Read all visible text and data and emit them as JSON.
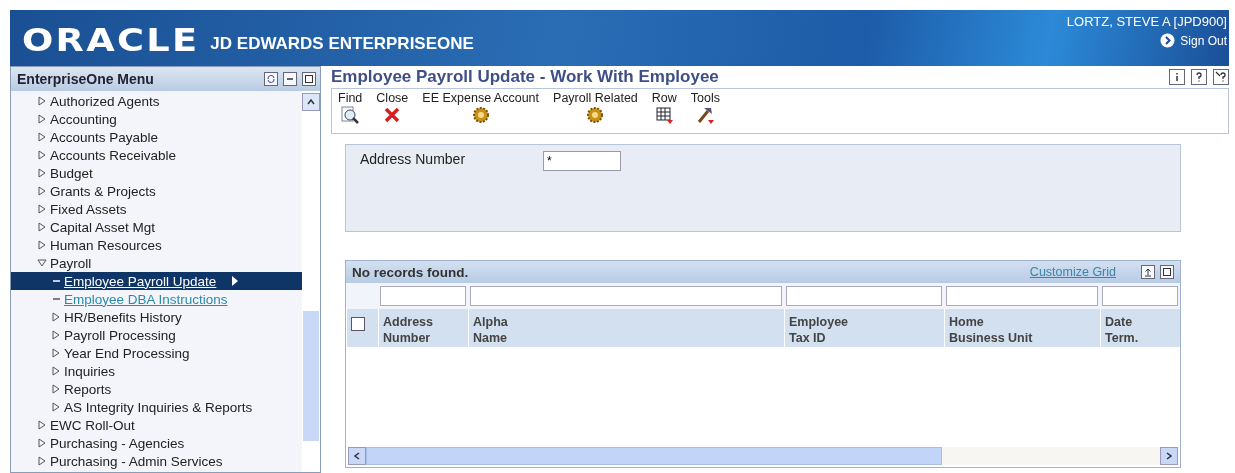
{
  "header": {
    "logo": "ORACLE",
    "product": "JD EDWARDS ENTERPRISEONE",
    "user": "LORTZ, STEVE A  [JPD900]",
    "sign_out": "Sign Out"
  },
  "sidebar": {
    "title": "EnterpriseOne Menu",
    "items": [
      {
        "label": "Authorized Agents",
        "kind": "folder",
        "expanded": false,
        "selected": false
      },
      {
        "label": "Accounting",
        "kind": "folder",
        "expanded": false,
        "selected": false
      },
      {
        "label": "Accounts Payable",
        "kind": "folder",
        "expanded": false,
        "selected": false
      },
      {
        "label": "Accounts Receivable",
        "kind": "folder",
        "expanded": false,
        "selected": false
      },
      {
        "label": "Budget",
        "kind": "folder",
        "expanded": false,
        "selected": false
      },
      {
        "label": "Grants & Projects",
        "kind": "folder",
        "expanded": false,
        "selected": false
      },
      {
        "label": "Fixed Assets",
        "kind": "folder",
        "expanded": false,
        "selected": false
      },
      {
        "label": "Capital Asset Mgt",
        "kind": "folder",
        "expanded": false,
        "selected": false
      },
      {
        "label": "Human Resources",
        "kind": "folder",
        "expanded": false,
        "selected": false
      },
      {
        "label": "Payroll",
        "kind": "folder",
        "expanded": true,
        "selected": false,
        "children": [
          {
            "label": "Employee Payroll Update",
            "kind": "task",
            "selected": true
          },
          {
            "label": "Employee DBA Instructions",
            "kind": "task",
            "selected": false
          },
          {
            "label": "HR/Benefits History",
            "kind": "folder",
            "expanded": false,
            "selected": false
          },
          {
            "label": "Payroll Processing",
            "kind": "folder",
            "expanded": false,
            "selected": false
          },
          {
            "label": "Year End Processing",
            "kind": "folder",
            "expanded": false,
            "selected": false
          },
          {
            "label": "Inquiries",
            "kind": "folder",
            "expanded": false,
            "selected": false
          },
          {
            "label": "Reports",
            "kind": "folder",
            "expanded": false,
            "selected": false
          },
          {
            "label": "AS Integrity Inquiries & Reports",
            "kind": "folder",
            "expanded": false,
            "selected": false
          }
        ]
      },
      {
        "label": "EWC Roll-Out",
        "kind": "folder",
        "expanded": false,
        "selected": false
      },
      {
        "label": "Purchasing - Agencies",
        "kind": "folder",
        "expanded": false,
        "selected": false
      },
      {
        "label": "Purchasing - Admin Services",
        "kind": "folder",
        "expanded": false,
        "selected": false
      }
    ]
  },
  "form": {
    "title": "Employee Payroll Update - Work With Employee",
    "toolbar": [
      "Find",
      "Close",
      "EE Expense Account",
      "Payroll Related",
      "Row",
      "Tools"
    ],
    "query": {
      "label": "Address Number",
      "value": "*"
    },
    "grid": {
      "status": "No records found.",
      "customize": "Customize Grid",
      "select_all": false,
      "columns": [
        [
          "Address",
          "Number"
        ],
        [
          "Alpha",
          "Name"
        ],
        [
          "Employee",
          "Tax ID"
        ],
        [
          "Home",
          "Business Unit"
        ],
        [
          "Date",
          "Term."
        ]
      ]
    }
  }
}
